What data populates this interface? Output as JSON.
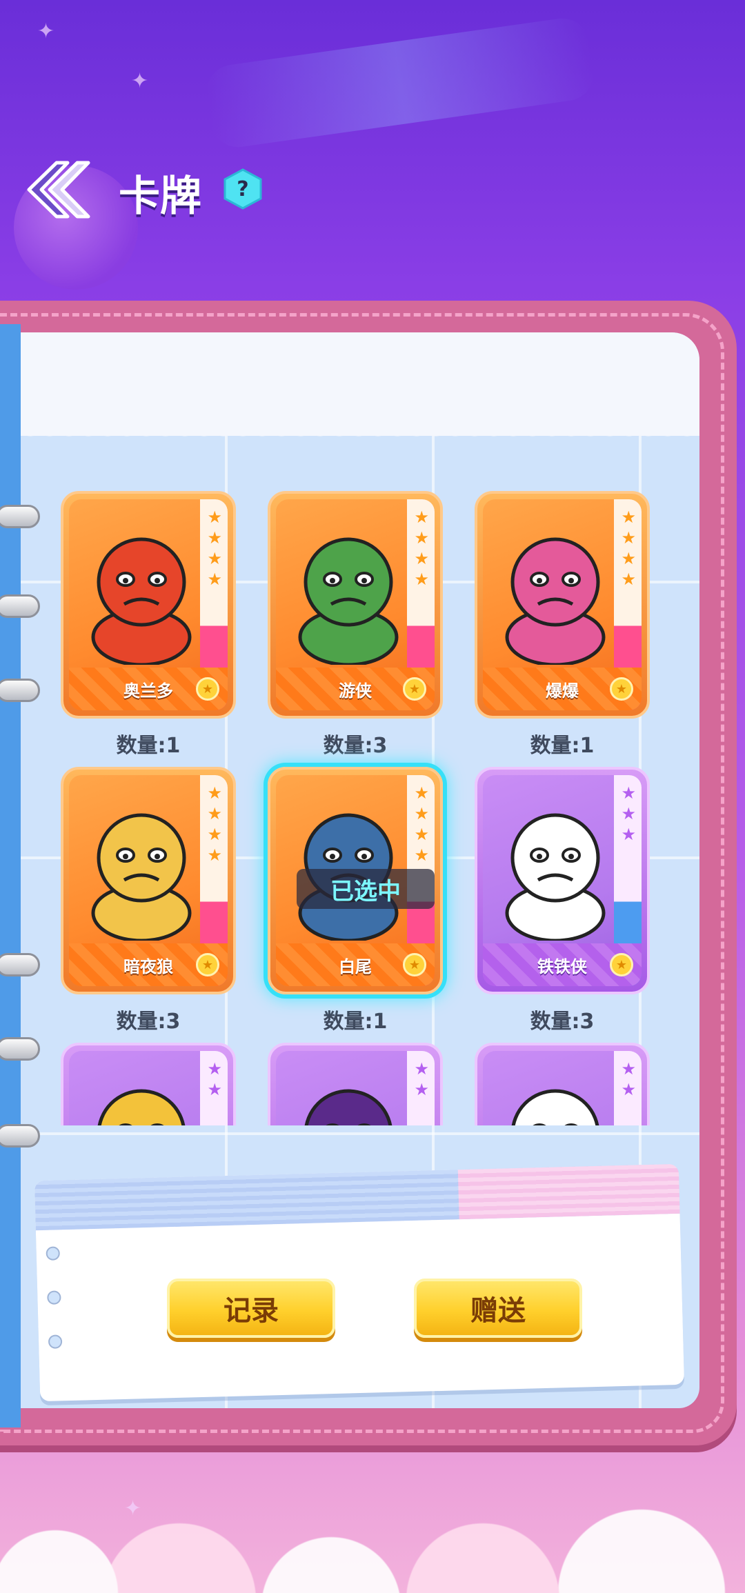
{
  "header": {
    "title": "卡牌",
    "help_label": "?"
  },
  "cards": [
    {
      "name": "奥兰多",
      "count": "数量:1",
      "rarity": "orange",
      "stars": 4,
      "selected": false
    },
    {
      "name": "游侠",
      "count": "数量:3",
      "rarity": "orange",
      "stars": 4,
      "selected": false
    },
    {
      "name": "爆爆",
      "count": "数量:1",
      "rarity": "orange",
      "stars": 4,
      "selected": false
    },
    {
      "name": "暗夜狼",
      "count": "数量:3",
      "rarity": "orange",
      "stars": 4,
      "selected": false
    },
    {
      "name": "白尾",
      "count": "数量:1",
      "rarity": "orange",
      "stars": 4,
      "selected": true,
      "selected_label": "已选中"
    },
    {
      "name": "铁铁侠",
      "count": "数量:3",
      "rarity": "purple",
      "stars": 3,
      "selected": false
    },
    {
      "name": "",
      "count": "",
      "rarity": "purple",
      "stars": 2,
      "selected": false
    },
    {
      "name": "",
      "count": "",
      "rarity": "purple",
      "stars": 2,
      "selected": false
    },
    {
      "name": "",
      "count": "",
      "rarity": "purple",
      "stars": 2,
      "selected": false
    }
  ],
  "actions": {
    "record_label": "记录",
    "gift_label": "赠送"
  },
  "colors": {
    "orange_card": "#ff8a2e",
    "purple_card": "#b57aee",
    "selected_glow": "#36e0f8",
    "button_yellow": "#ffd02c"
  }
}
